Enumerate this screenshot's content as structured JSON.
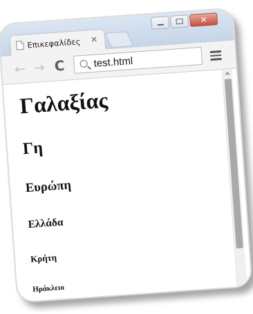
{
  "browser": {
    "tab": {
      "title": "Επικεφαλίδες",
      "close_glyph": "×"
    },
    "window_controls": {
      "close_glyph": "✕"
    },
    "toolbar": {
      "back_glyph": "←",
      "forward_glyph": "→",
      "reload_glyph": "C",
      "address": "test.html"
    }
  },
  "page": {
    "headings": [
      {
        "level": 1,
        "text": "Γαλαξίας"
      },
      {
        "level": 2,
        "text": "Γη"
      },
      {
        "level": 3,
        "text": "Ευρώπη"
      },
      {
        "level": 4,
        "text": "Ελλάδα"
      },
      {
        "level": 5,
        "text": "Κρήτη"
      },
      {
        "level": 6,
        "text": "Ηράκλειο"
      }
    ]
  },
  "icons": {
    "tab": "page-icon",
    "search": "search-icon",
    "menu": "hamburger-menu-icon",
    "reload": "reload-icon"
  },
  "colors": {
    "titlebar": "#cfdcec",
    "close_button": "#c8503f",
    "toolbar": "#f3f3f3",
    "page_background": "#ffffff",
    "scroll_thumb": "#a9a9a9"
  }
}
